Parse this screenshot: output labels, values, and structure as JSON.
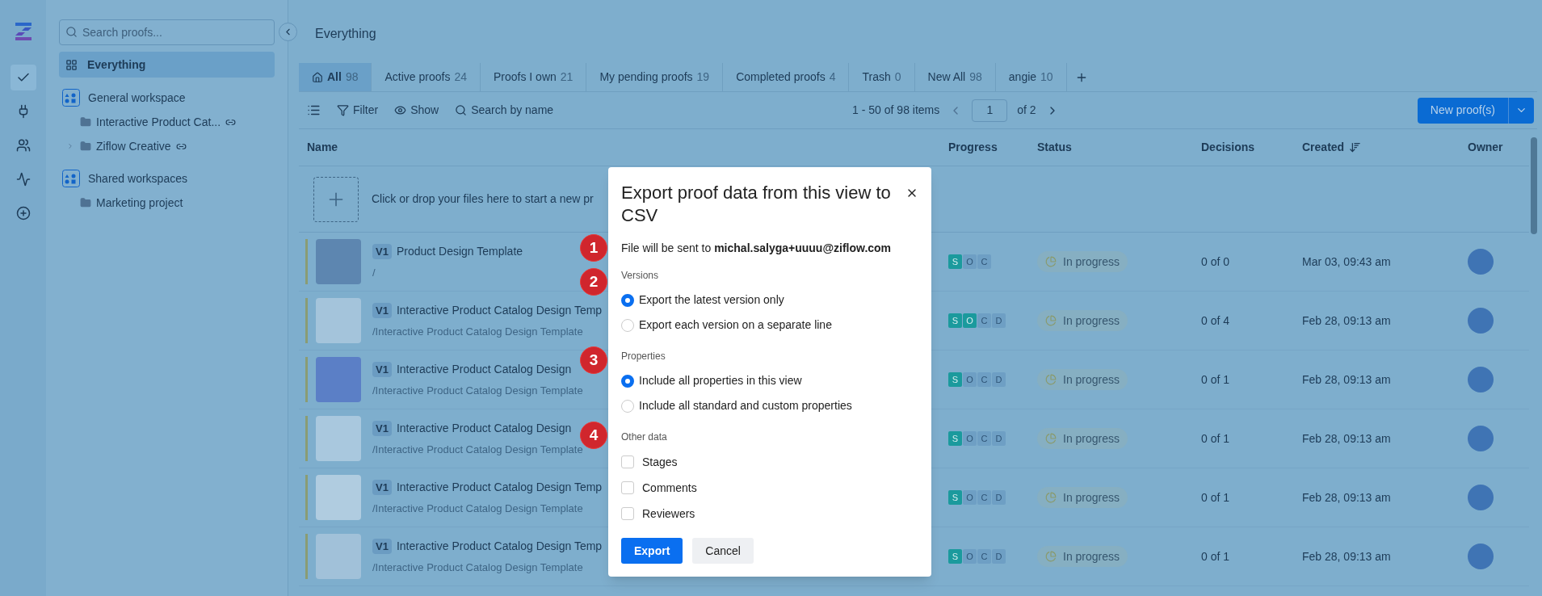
{
  "rail": [
    {
      "kind": "check",
      "selected": true
    },
    {
      "kind": "plug",
      "selected": false
    },
    {
      "kind": "users",
      "selected": false
    },
    {
      "kind": "activity",
      "selected": false
    },
    {
      "kind": "add",
      "selected": false
    }
  ],
  "sidebar": {
    "search": {
      "placeholder": "Search proofs..."
    },
    "items": [
      {
        "label": "Everything",
        "selected": true
      }
    ],
    "workspaces": [
      {
        "name": "General workspace",
        "folders": [
          {
            "label": "Interactive Product Cat...",
            "linked": true,
            "expandable": false
          },
          {
            "label": "Ziflow Creative",
            "linked": true,
            "expandable": true
          }
        ]
      },
      {
        "name": "Shared workspaces",
        "folders": [
          {
            "label": "Marketing project",
            "linked": false,
            "expandable": false
          }
        ]
      }
    ]
  },
  "header": {
    "title": "Everything"
  },
  "tabs": [
    {
      "label": "All",
      "count": "98",
      "selected": true
    },
    {
      "label": "Active proofs",
      "count": "24",
      "selected": false
    },
    {
      "label": "Proofs I own",
      "count": "21",
      "selected": false
    },
    {
      "label": "My pending proofs",
      "count": "19",
      "selected": false
    },
    {
      "label": "Completed proofs",
      "count": "4",
      "selected": false
    },
    {
      "label": "Trash",
      "count": "0",
      "selected": false
    },
    {
      "label": "New All",
      "count": "98",
      "selected": false
    },
    {
      "label": "angie",
      "count": "10",
      "selected": false
    }
  ],
  "toolbar": {
    "filter": "Filter",
    "show": "Show",
    "search": "Search by name",
    "range": "1 - 50 of 98 items",
    "page": "1",
    "of": "of 2",
    "new_button": "New proof(s)"
  },
  "table": {
    "columns": [
      {
        "label": "Name",
        "sorted": false
      },
      {
        "label": "Progress",
        "sorted": false
      },
      {
        "label": "Status",
        "sorted": false
      },
      {
        "label": "Decisions",
        "sorted": false
      },
      {
        "label": "Created",
        "sorted": true
      },
      {
        "label": "Owner",
        "sorted": false
      }
    ],
    "upload_text": "Click or drop your files here to start a new pr",
    "rows": [
      {
        "version": "V1",
        "title": "Product Design Template",
        "path": "/",
        "stages": [
          {
            "label": "S",
            "done": true
          },
          {
            "label": "O",
            "done": false
          },
          {
            "label": "C",
            "done": false
          }
        ],
        "status": "In progress",
        "decisions": "0 of 0",
        "created": "Mar 03, 09:43 am"
      },
      {
        "version": "V1",
        "title": "Interactive Product Catalog Design Temp",
        "path": "/Interactive Product Catalog Design Template",
        "stages": [
          {
            "label": "S",
            "done": true
          },
          {
            "label": "O",
            "done": true
          },
          {
            "label": "C",
            "done": false
          },
          {
            "label": "D",
            "done": false
          }
        ],
        "status": "In progress",
        "decisions": "0 of 4",
        "created": "Feb 28, 09:13 am"
      },
      {
        "version": "V1",
        "title": "Interactive Product Catalog Design",
        "path": "/Interactive Product Catalog Design Template",
        "stages": [
          {
            "label": "S",
            "done": true
          },
          {
            "label": "O",
            "done": false
          },
          {
            "label": "C",
            "done": false
          },
          {
            "label": "D",
            "done": false
          }
        ],
        "status": "In progress",
        "decisions": "0 of 1",
        "created": "Feb 28, 09:13 am"
      },
      {
        "version": "V1",
        "title": "Interactive Product Catalog Design",
        "path": "/Interactive Product Catalog Design Template",
        "stages": [
          {
            "label": "S",
            "done": true
          },
          {
            "label": "O",
            "done": false
          },
          {
            "label": "C",
            "done": false
          },
          {
            "label": "D",
            "done": false
          }
        ],
        "status": "In progress",
        "decisions": "0 of 1",
        "created": "Feb 28, 09:13 am"
      },
      {
        "version": "V1",
        "title": "Interactive Product Catalog Design Temp",
        "path": "/Interactive Product Catalog Design Template",
        "stages": [
          {
            "label": "S",
            "done": true
          },
          {
            "label": "O",
            "done": false
          },
          {
            "label": "C",
            "done": false
          },
          {
            "label": "D",
            "done": false
          }
        ],
        "status": "In progress",
        "decisions": "0 of 1",
        "created": "Feb 28, 09:13 am"
      },
      {
        "version": "V1",
        "title": "Interactive Product Catalog Design Temp",
        "path": "/Interactive Product Catalog Design Template",
        "stages": [
          {
            "label": "S",
            "done": true
          },
          {
            "label": "O",
            "done": false
          },
          {
            "label": "C",
            "done": false
          },
          {
            "label": "D",
            "done": false
          }
        ],
        "status": "In progress",
        "decisions": "0 of 1",
        "created": "Feb 28, 09:13 am"
      }
    ]
  },
  "modal": {
    "title": "Export proof data from this view to CSV",
    "recipient": "File will be sent to **michal.salyga+uuuu@ziflow.com**",
    "groups": [
      {
        "label": "Versions",
        "kind": "radio",
        "options": [
          {
            "label": "Export the latest version only",
            "selected": true
          },
          {
            "label": "Export each version on a separate line",
            "selected": false
          }
        ]
      },
      {
        "label": "Properties",
        "kind": "radio",
        "options": [
          {
            "label": "Include all properties in this view",
            "selected": true
          },
          {
            "label": "Include all standard and custom properties",
            "selected": false
          }
        ]
      },
      {
        "label": "Other data",
        "kind": "checkbox",
        "options": [
          {
            "label": "Stages",
            "checked": false
          },
          {
            "label": "Comments",
            "checked": false
          },
          {
            "label": "Reviewers",
            "checked": false
          }
        ]
      }
    ],
    "export": "Export",
    "cancel": "Cancel"
  },
  "callouts": [
    "1",
    "2",
    "3",
    "4"
  ]
}
